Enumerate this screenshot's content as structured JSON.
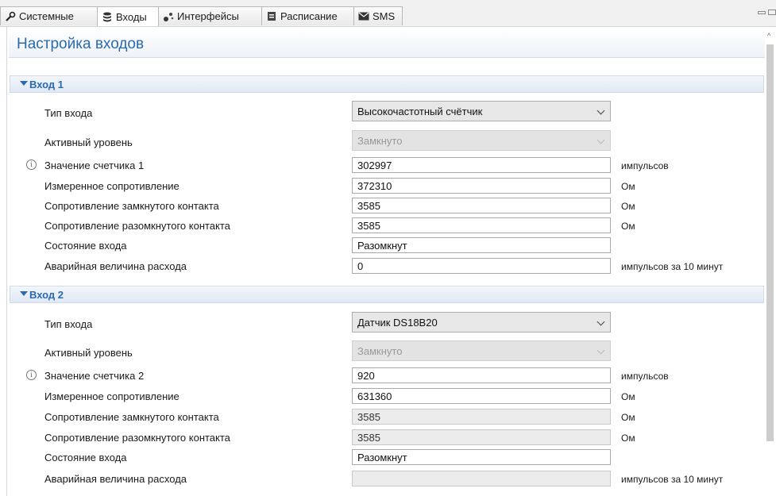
{
  "tabs": [
    {
      "label": "Системные",
      "icon": "wrench-icon"
    },
    {
      "label": "Входы",
      "icon": "database-icon"
    },
    {
      "label": "Интерфейсы",
      "icon": "network-icon"
    },
    {
      "label": "Расписание",
      "icon": "calendar-icon"
    },
    {
      "label": "SMS",
      "icon": "envelope-icon"
    }
  ],
  "page_title": "Настройка входов",
  "labels": {
    "input_type": "Тип входа",
    "active_level": "Активный уровень",
    "measured_resistance": "Измеренное сопротивление",
    "closed_resistance": "Сопротивление замкнутого контакта",
    "open_resistance": "Сопротивление разомкнутого контакта",
    "input_state": "Состояние входа",
    "alarm_flow": "Аварийная величина расхода"
  },
  "units": {
    "pulses": "импульсов",
    "ohm": "Ом",
    "pulses_per_10min": "импульсов за 10 минут"
  },
  "inputs": [
    {
      "header": "Вход 1",
      "input_type": "Высокочастотный счётчик",
      "active_level": "Замкнуто",
      "counter_label": "Значение счетчика 1",
      "counter_value": "302997",
      "measured_resistance": "372310",
      "closed_resistance": "3585",
      "open_resistance": "3585",
      "state": "Разомкнут",
      "alarm_flow": "0"
    },
    {
      "header": "Вход 2",
      "input_type": "Датчик DS18B20",
      "active_level": "Замкнуто",
      "counter_label": "Значение счетчика 2",
      "counter_value": "920",
      "measured_resistance": "631360",
      "closed_resistance": "3585",
      "open_resistance": "3585",
      "state": "Разомкнут",
      "alarm_flow": ""
    }
  ]
}
